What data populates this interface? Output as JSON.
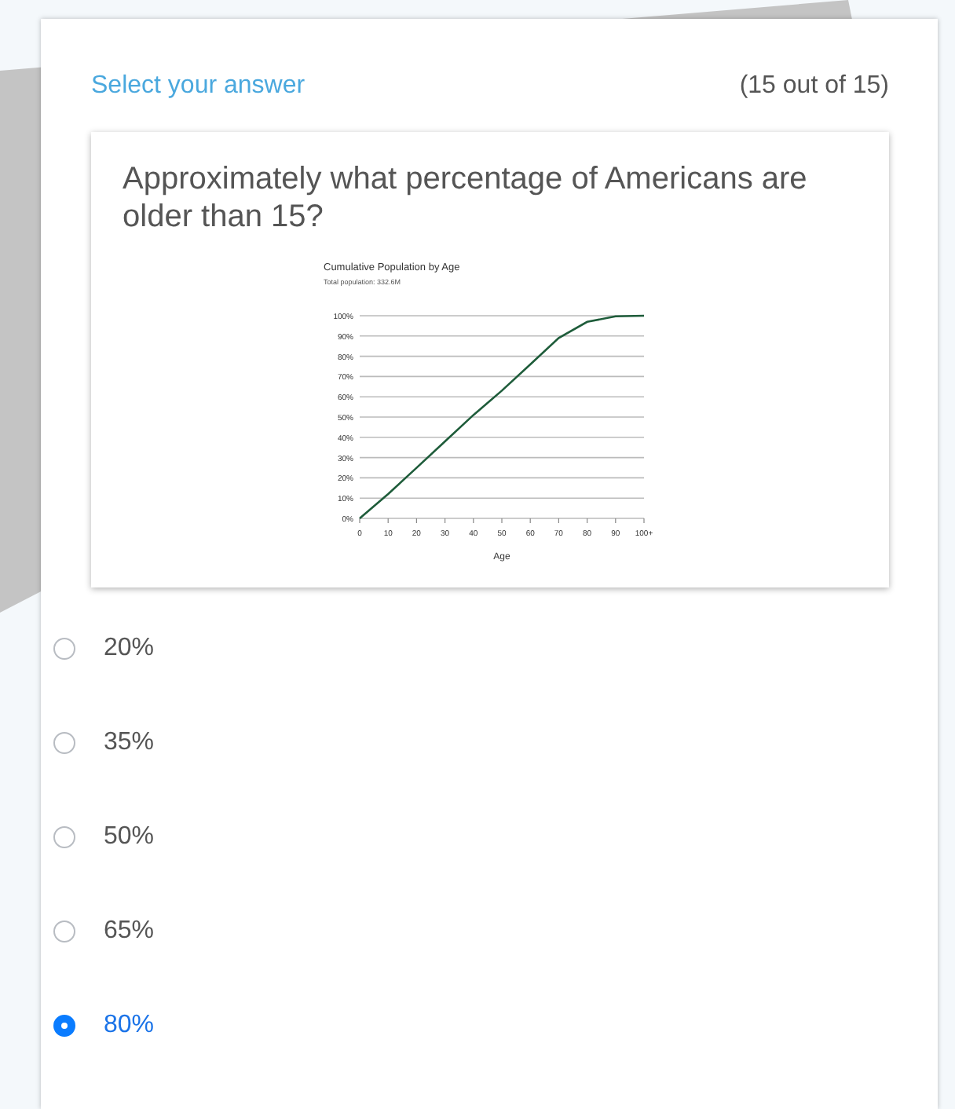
{
  "header": {
    "title": "Select your answer",
    "progress": "(15 out of 15)"
  },
  "question": {
    "text": "Approximately what percentage of Americans are older than 15?",
    "chart_data": {
      "type": "line",
      "title": "Cumulative Population by Age",
      "subtitle": "Total population: 332.6M",
      "xlabel": "Age",
      "x": [
        0,
        10,
        20,
        30,
        40,
        50,
        60,
        70,
        80,
        90,
        100
      ],
      "grid": true,
      "series": [
        {
          "color": "#1e5c3a",
          "values": [
            0,
            12,
            25,
            38,
            51,
            63,
            76,
            89,
            97,
            99.7,
            100
          ]
        }
      ],
      "xlim": [
        0,
        100
      ],
      "ylim": [
        0,
        100
      ],
      "xticks": [
        0,
        10,
        20,
        30,
        40,
        50,
        60,
        70,
        80,
        90,
        {
          "value": 100,
          "label": "100+"
        }
      ],
      "yticks": [
        {
          "value": 0,
          "label": "0%"
        },
        {
          "value": 10,
          "label": "10%"
        },
        {
          "value": 20,
          "label": "20%"
        },
        {
          "value": 30,
          "label": "30%"
        },
        {
          "value": 40,
          "label": "40%"
        },
        {
          "value": 50,
          "label": "50%"
        },
        {
          "value": 60,
          "label": "60%"
        },
        {
          "value": 70,
          "label": "70%"
        },
        {
          "value": 80,
          "label": "80%"
        },
        {
          "value": 90,
          "label": "90%"
        },
        {
          "value": 100,
          "label": "100%"
        }
      ]
    }
  },
  "options": [
    {
      "label": "20%",
      "selected": false
    },
    {
      "label": "35%",
      "selected": false
    },
    {
      "label": "50%",
      "selected": false
    },
    {
      "label": "65%",
      "selected": false
    },
    {
      "label": "80%",
      "selected": true
    }
  ]
}
